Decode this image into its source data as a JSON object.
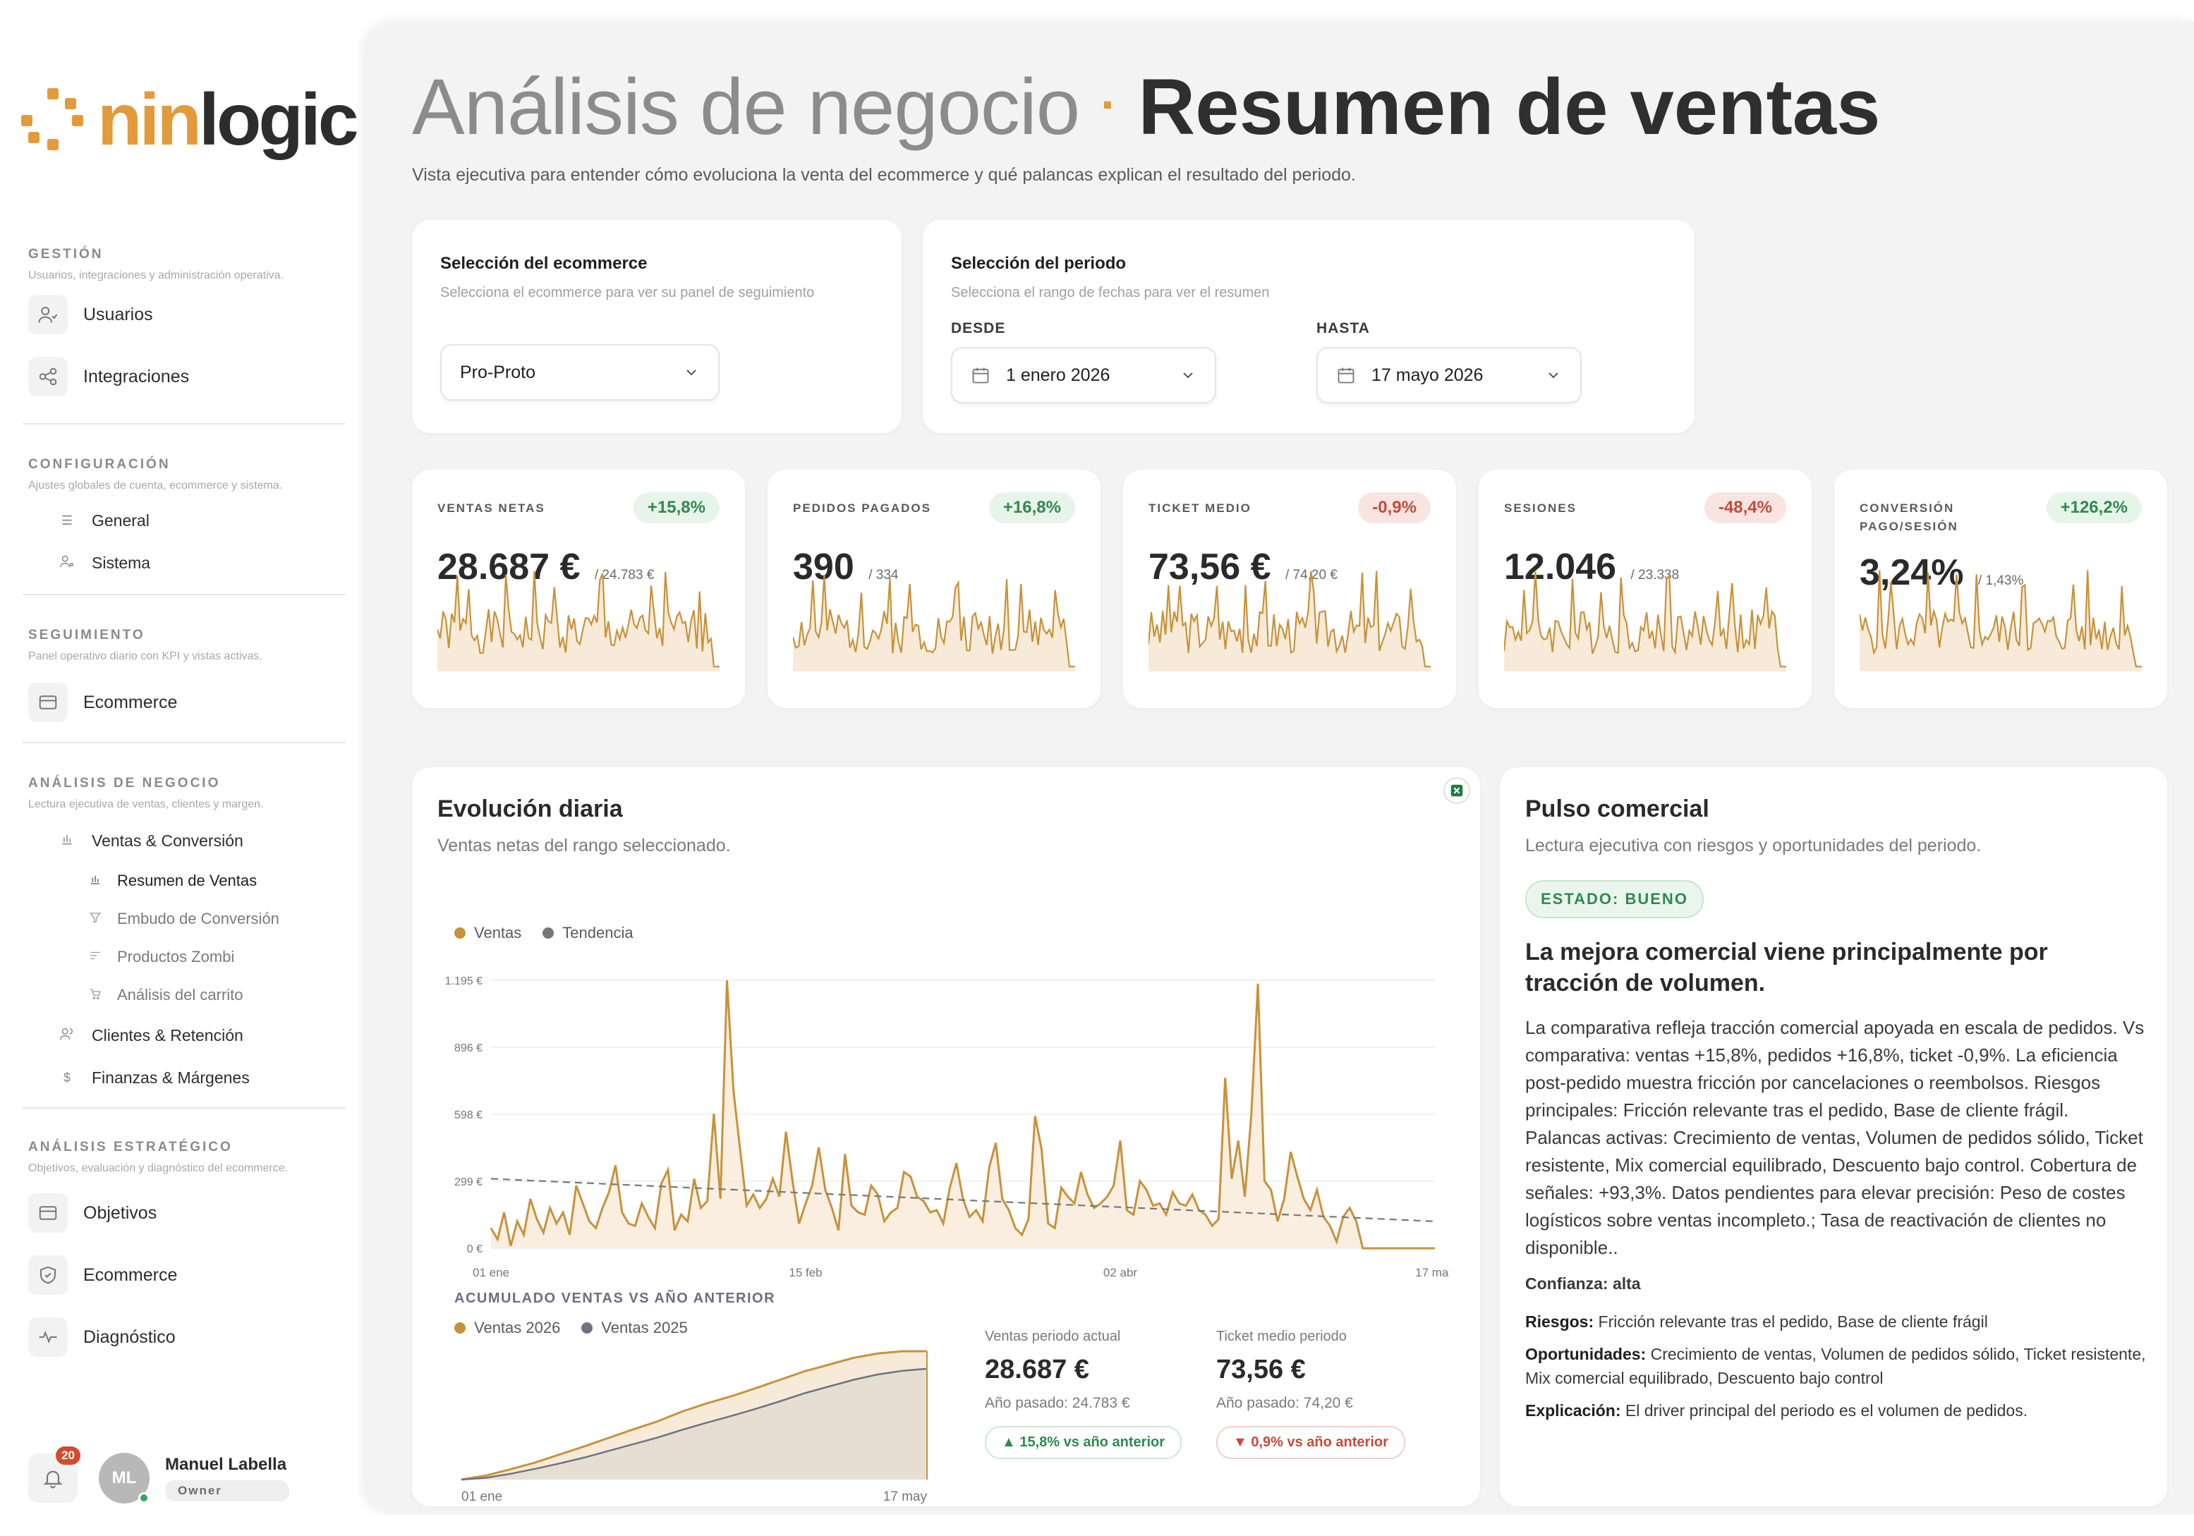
{
  "brand": {
    "part1": "nin",
    "part2": "logic"
  },
  "sidebar": {
    "sections": [
      {
        "title": "GESTIÓN",
        "desc": "Usuarios, integraciones y administración operativa.",
        "items": [
          "Usuarios",
          "Integraciones"
        ]
      },
      {
        "title": "CONFIGURACIÓN",
        "desc": "Ajustes globales de cuenta, ecommerce y sistema.",
        "items": [
          "General",
          "Sistema"
        ]
      },
      {
        "title": "SEGUIMIENTO",
        "desc": "Panel operativo diario con KPI y vistas activas.",
        "items": [
          "Ecommerce"
        ]
      },
      {
        "title": "ANÁLISIS DE NEGOCIO",
        "desc": "Lectura ejecutiva de ventas, clientes y margen.",
        "items": [
          "Ventas & Conversión",
          "Resumen de Ventas",
          "Embudo de Conversión",
          "Productos Zombi",
          "Análisis del carrito",
          "Clientes & Retención",
          "Finanzas & Márgenes"
        ]
      },
      {
        "title": "ANÁLISIS ESTRATÉGICO",
        "desc": "Objetivos, evaluación y diagnóstico del ecommerce.",
        "items": [
          "Objetivos",
          "Ecommerce",
          "Diagnóstico"
        ]
      }
    ],
    "notifications": "20",
    "user": {
      "initials": "ML",
      "name": "Manuel Labella",
      "role": "Owner"
    }
  },
  "header": {
    "title_light": "Análisis de negocio",
    "separator": "·",
    "title_bold": "Resumen de ventas",
    "subtitle": "Vista ejecutiva para entender cómo evoluciona la venta del ecommerce y qué palancas explican el resultado del periodo."
  },
  "ecommerce_card": {
    "title": "Selección del ecommerce",
    "desc": "Selecciona el ecommerce para ver su panel de seguimiento",
    "value": "Pro-Proto"
  },
  "period_card": {
    "title": "Selección del periodo",
    "desc": "Selecciona el rango de fechas para ver el resumen",
    "from_label": "DESDE",
    "from_value": "1 enero 2026",
    "to_label": "HASTA",
    "to_value": "17 mayo 2026"
  },
  "kpis": [
    {
      "label": "VENTAS NETAS",
      "badge": "+15,8%",
      "value": "28.687 €",
      "prev": "/ 24.783 €",
      "trend": "up"
    },
    {
      "label": "PEDIDOS PAGADOS",
      "badge": "+16,8%",
      "value": "390",
      "prev": "/ 334",
      "trend": "up"
    },
    {
      "label": "TICKET MEDIO",
      "badge": "-0,9%",
      "value": "73,56 €",
      "prev": "/ 74,20 €",
      "trend": "down"
    },
    {
      "label": "SESIONES",
      "badge": "-48,4%",
      "value": "12.046",
      "prev": "/ 23.338",
      "trend": "down"
    },
    {
      "label": "CONVERSIÓN PAGO/SESIÓN",
      "badge": "+126,2%",
      "value": "3,24%",
      "prev": "/ 1,43%",
      "trend": "up"
    }
  ],
  "evolution": {
    "title": "Evolución diaria",
    "subtitle": "Ventas netas del rango seleccionado.",
    "legend": [
      "Ventas",
      "Tendencia"
    ],
    "cumulative_title": "ACUMULADO VENTAS VS AÑO ANTERIOR",
    "cumulative_legend": [
      "Ventas 2026",
      "Ventas 2025"
    ],
    "cum_x_start": "01 ene",
    "cum_x_end": "17 may",
    "stat1": {
      "label": "Ventas periodo actual",
      "value": "28.687 €",
      "prev": "Año pasado: 24.783 €",
      "pill": "15,8% vs año anterior"
    },
    "stat2": {
      "label": "Ticket medio periodo",
      "value": "73,56 €",
      "prev": "Año pasado: 74,20 €",
      "pill": "0,9% vs año anterior"
    }
  },
  "chart_data": [
    {
      "type": "line",
      "title": "Evolución diaria",
      "y_ticks": [
        "1.195 €",
        "896 €",
        "598 €",
        "299 €",
        "0 €"
      ],
      "x_ticks": [
        "01 ene",
        "15 feb",
        "02 abr",
        "17 may"
      ],
      "ylim": [
        0,
        1195
      ],
      "series": [
        {
          "name": "Ventas",
          "values": [
            90,
            40,
            160,
            10,
            120,
            60,
            220,
            130,
            70,
            180,
            110,
            160,
            60,
            280,
            200,
            120,
            90,
            180,
            250,
            370,
            160,
            110,
            100,
            200,
            140,
            90,
            290,
            350,
            80,
            150,
            120,
            310,
            180,
            210,
            600,
            220,
            1195,
            700,
            440,
            190,
            240,
            180,
            220,
            310,
            230,
            520,
            300,
            110,
            200,
            280,
            450,
            260,
            180,
            80,
            420,
            190,
            160,
            150,
            280,
            240,
            120,
            160,
            180,
            340,
            320,
            230,
            210,
            160,
            170,
            110,
            270,
            380,
            220,
            140,
            170,
            120,
            360,
            470,
            220,
            170,
            90,
            60,
            130,
            590,
            440,
            110,
            90,
            270,
            230,
            200,
            340,
            240,
            180,
            200,
            230,
            280,
            480,
            170,
            150,
            300,
            260,
            190,
            200,
            150,
            250,
            200,
            190,
            240,
            170,
            150,
            100,
            130,
            760,
            310,
            480,
            230,
            600,
            1180,
            300,
            260,
            120,
            220,
            430,
            320,
            220,
            170,
            260,
            140,
            100,
            30,
            140,
            180,
            120,
            0,
            0,
            0,
            0,
            0,
            0,
            0,
            0,
            0,
            0,
            0,
            0
          ]
        },
        {
          "name": "Tendencia",
          "values": [
            310,
            120
          ]
        }
      ]
    },
    {
      "type": "area",
      "title": "ACUMULADO VENTAS VS AÑO ANTERIOR",
      "x_ticks": [
        "01 ene",
        "17 may"
      ],
      "series": [
        {
          "name": "Ventas 2026",
          "values": [
            0,
            900,
            2300,
            3800,
            5600,
            7400,
            9300,
            11200,
            13000,
            15200,
            17000,
            18600,
            20400,
            22300,
            24200,
            25700,
            27200,
            28200,
            28687,
            28687
          ]
        },
        {
          "name": "Ventas 2025",
          "values": [
            0,
            400,
            1300,
            2400,
            3600,
            4900,
            6400,
            7900,
            9400,
            11100,
            12700,
            14200,
            15800,
            17500,
            19300,
            20800,
            22300,
            23500,
            24300,
            24783
          ]
        }
      ]
    }
  ],
  "pulse": {
    "title": "Pulso comercial",
    "subtitle": "Lectura ejecutiva con riesgos y oportunidades del periodo.",
    "status": "ESTADO: BUENO",
    "headline": "La mejora comercial viene principalmente por tracción de volumen.",
    "body": "La comparativa refleja tracción comercial apoyada en escala de pedidos. Vs comparativa: ventas +15,8%, pedidos +16,8%, ticket -0,9%. La eficiencia post-pedido muestra fricción por cancelaciones o reembolsos. Riesgos principales: Fricción relevante tras el pedido, Base de cliente frágil. Palancas activas: Crecimiento de ventas, Volumen de pedidos sólido, Ticket resistente, Mix comercial equilibrado, Descuento bajo control. Cobertura de señales: +93,3%. Datos pendientes para elevar precisión: Peso de costes logísticos sobre ventas incompleto.; Tasa de reactivación de clientes no disponible..",
    "confidence": "Confianza: alta",
    "risks_label": "Riesgos:",
    "risks": "Fricción relevante tras el pedido, Base de cliente frágil",
    "opps_label": "Oportunidades:",
    "opps": "Crecimiento de ventas, Volumen de pedidos sólido, Ticket resistente, Mix comercial equilibrado, Descuento bajo control",
    "expl_label": "Explicación:",
    "expl": "El driver principal del periodo es el volumen de pedidos."
  },
  "colors": {
    "accent": "#c8923a",
    "accent_fill": "#f7ead8",
    "trend": "#777777",
    "prev_year_fill": "#e6ded2",
    "prev_year_line": "#6e7380",
    "up": "#2f8a4f",
    "down": "#c44b3b"
  }
}
